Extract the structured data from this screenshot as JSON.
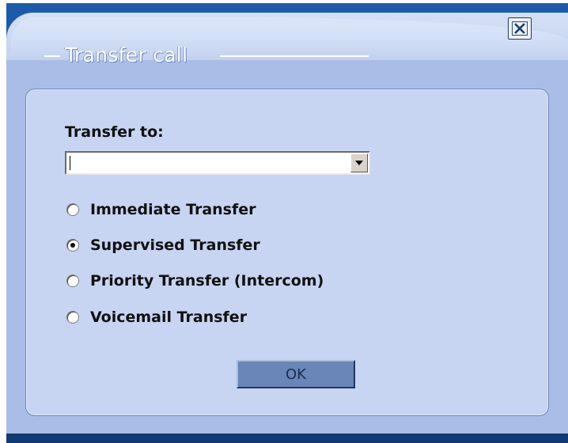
{
  "dialog": {
    "title": "Transfer call",
    "close_icon": "close-box-icon"
  },
  "form": {
    "transfer_to_label": "Transfer to:",
    "transfer_to_value": "",
    "dropdown_icon": "chevron-down-icon"
  },
  "options": [
    {
      "label": "Immediate Transfer",
      "checked": false
    },
    {
      "label": "Supervised Transfer",
      "checked": true
    },
    {
      "label": "Priority Transfer (Intercom)",
      "checked": false
    },
    {
      "label": "Voicemail Transfer",
      "checked": false
    }
  ],
  "buttons": {
    "ok_label": "OK"
  },
  "colors": {
    "header_dark": "#1d5baa",
    "panel_bg": "#c7d5f3",
    "button_bg": "#6a86b8"
  }
}
